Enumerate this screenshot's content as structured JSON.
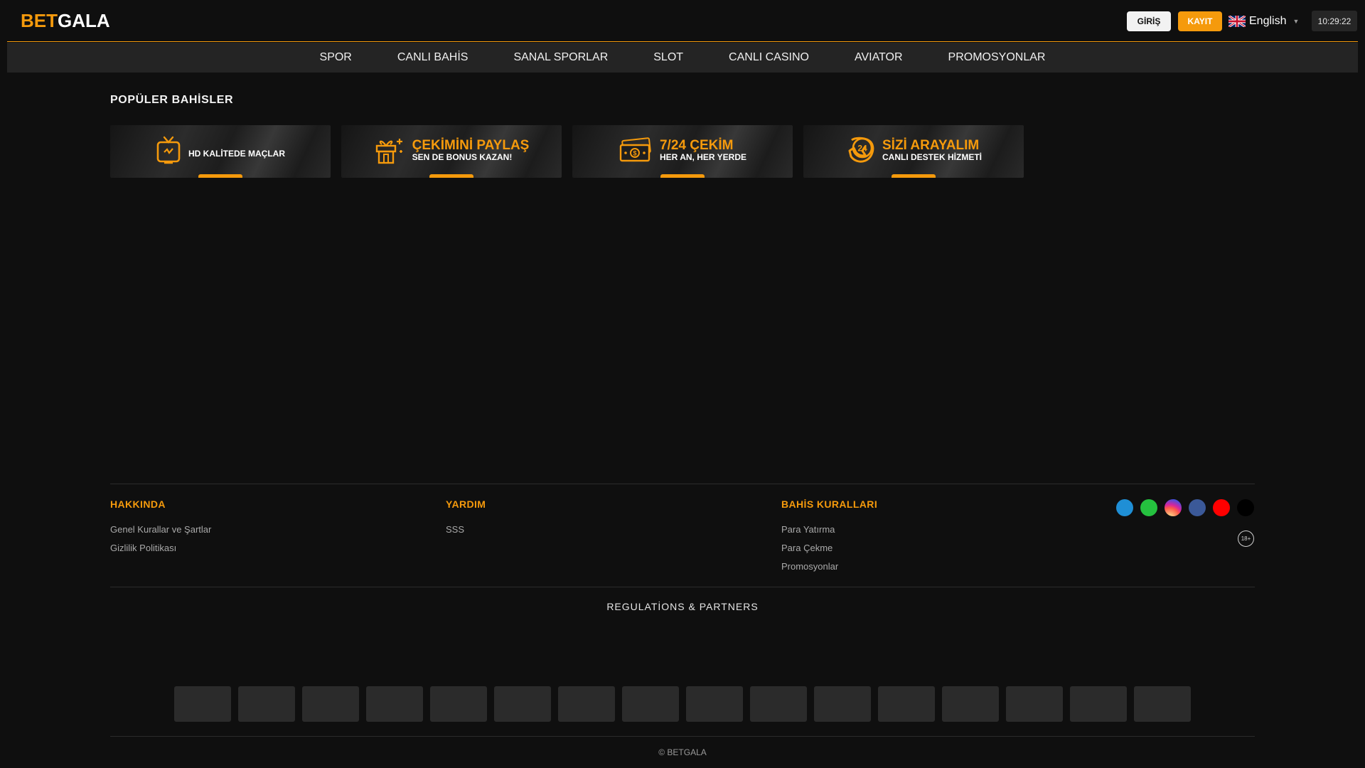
{
  "brand": {
    "part1": "BET",
    "part2": "GALA"
  },
  "header": {
    "login_label": "GİRİŞ",
    "register_label": "KAYIT",
    "language": "English",
    "time": "10:29:22"
  },
  "nav": {
    "items": [
      "SPOR",
      "CANLI BAHİS",
      "SANAL SPORLAR",
      "SLOT",
      "CANLI CASINO",
      "AVIATOR",
      "PROMOSYONLAR"
    ]
  },
  "popular": {
    "title": "POPÜLER BAHİSLER",
    "cards": [
      {
        "icon": "tv-icon",
        "line1": "",
        "line2": "HD KALİTEDE MAÇLAR"
      },
      {
        "icon": "gift-icon",
        "line1": "ÇEKİMİNİ PAYLAŞ",
        "line2": "SEN DE BONUS KAZAN!"
      },
      {
        "icon": "cash-icon",
        "line1": "7/24 ÇEKİM",
        "line2": "HER AN, HER YERDE"
      },
      {
        "icon": "phone-24-icon",
        "line1": "SİZİ ARAYALIM",
        "line2": "CANLI DESTEK HİZMETİ"
      }
    ]
  },
  "footer": {
    "about": {
      "title": "HAKKINDA",
      "links": [
        "Genel Kurallar ve Şartlar",
        "Gizlilik Politikası"
      ]
    },
    "help": {
      "title": "YARDIM",
      "links": [
        "SSS"
      ]
    },
    "rules": {
      "title": "BAHİS KURALLARI",
      "links": [
        "Para Yatırma",
        "Para Çekme",
        "Promosyonlar"
      ]
    },
    "socials": [
      {
        "name": "telegram-icon",
        "color": "#1f8fd6"
      },
      {
        "name": "whatsapp-icon",
        "color": "#25c13f"
      },
      {
        "name": "instagram-icon",
        "color": "#d6307a"
      },
      {
        "name": "facebook-icon",
        "color": "#3b5998"
      },
      {
        "name": "youtube-icon",
        "color": "#ff0000"
      },
      {
        "name": "x-icon",
        "color": "#000000"
      }
    ],
    "age_badge": "18+",
    "regulations_title": "REGULATİONS & PARTNERS",
    "partner_count": 16,
    "copyright": "© BETGALA"
  },
  "colors": {
    "accent": "#f59a0c",
    "background": "#0f0f0f",
    "nav_bg": "#242424"
  }
}
